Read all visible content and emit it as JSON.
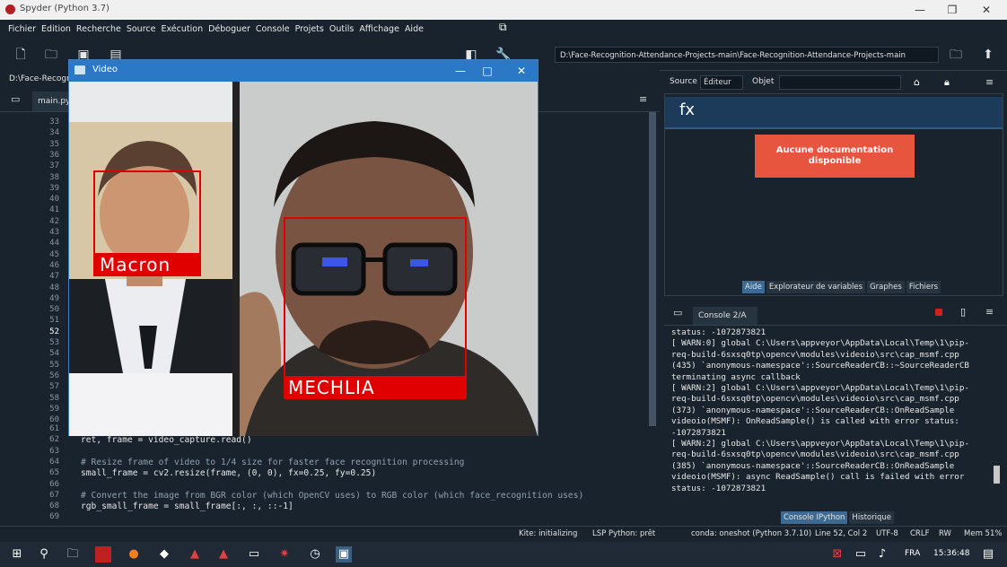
{
  "app": {
    "title": "Spyder (Python 3.7)",
    "controls": {
      "minimize": "—",
      "maximize": "❐",
      "close": "✕"
    }
  },
  "menu": [
    "Fichier",
    "Edition",
    "Recherche",
    "Source",
    "Exécution",
    "Déboguer",
    "Console",
    "Projets",
    "Outils",
    "Affichage",
    "Aide"
  ],
  "toolbar": {
    "path": "D:\\Face-Recognition-Attendance-Projects-main\\Face-Recognition-Attendance-Projects-main"
  },
  "editor": {
    "path": "D:\\Face-Recogni",
    "tab": "main.py",
    "line_numbers_top": [
      "33",
      "34",
      "35",
      "36",
      "37",
      "38",
      "39",
      "40",
      "41",
      "42",
      "43",
      "44",
      "45",
      "46",
      "47",
      "48",
      "49",
      "50",
      "51",
      "52",
      "53",
      "54",
      "55",
      "56",
      "57",
      "58",
      "59",
      "60"
    ],
    "line_numbers_bottom": [
      "61",
      "62",
      "63",
      "64",
      "65",
      "66",
      "67",
      "68",
      "69"
    ],
    "code_bottom": [
      "",
      "ret, frame = video_capture.read()",
      "",
      "# Resize frame of video to 1/4 size for faster face recognition processing",
      "small_frame = cv2.resize(frame, (0, 0), fx=0.25, fy=0.25)",
      "",
      "# Convert the image from BGR color (which OpenCV uses) to RGB color (which face_recognition uses)",
      "rgb_small_frame = small_frame[:, :, ::-1]",
      ""
    ]
  },
  "help": {
    "source_label": "Source",
    "source_value": "Éditeur",
    "object_label": "Objet",
    "fx": "fx",
    "no_doc": "Aucune documentation disponible",
    "tabs": [
      "Aide",
      "Explorateur de variables",
      "Graphes",
      "Fichiers"
    ]
  },
  "console": {
    "tab": "Console 2/A",
    "lines": [
      "status: -1072873821",
      "[ WARN:0] global C:\\Users\\appveyor\\AppData\\Local\\Temp\\1\\pip-",
      "req-build-6sxsq0tp\\opencv\\modules\\videoio\\src\\cap_msmf.cpp",
      "(435) `anonymous-namespace'::SourceReaderCB::~SourceReaderCB",
      "terminating async callback",
      "[ WARN:2] global C:\\Users\\appveyor\\AppData\\Local\\Temp\\1\\pip-",
      "req-build-6sxsq0tp\\opencv\\modules\\videoio\\src\\cap_msmf.cpp",
      "(373) `anonymous-namespace'::SourceReaderCB::OnReadSample",
      "videoio(MSMF): OnReadSample() is called with error status:",
      "-1072873821",
      "[ WARN:2] global C:\\Users\\appveyor\\AppData\\Local\\Temp\\1\\pip-",
      "req-build-6sxsq0tp\\opencv\\modules\\videoio\\src\\cap_msmf.cpp",
      "(385) `anonymous-namespace'::SourceReaderCB::OnReadSample",
      "videoio(MSMF): async ReadSample() call is failed with error",
      "status: -1072873821"
    ],
    "bottom_tabs": [
      "Console IPython",
      "Historique"
    ]
  },
  "status": {
    "kite": "Kite: initializing",
    "lsp": "LSP Python: prêt",
    "conda": "conda: oneshot (Python 3.7.10)",
    "cursor": "Line 52, Col 2",
    "encoding": "UTF-8",
    "eol": "CRLF",
    "rw": "RW",
    "mem": "Mem 51%"
  },
  "video": {
    "title": "Video",
    "labels": [
      "Macron",
      "MECHLIA"
    ]
  },
  "taskbar": {
    "lang": "FRA",
    "time": "15:36:48"
  },
  "colors": {
    "bg": "#19232d",
    "accent": "#2b78c6",
    "box": "#e00000",
    "nodoc": "#e8553f"
  }
}
